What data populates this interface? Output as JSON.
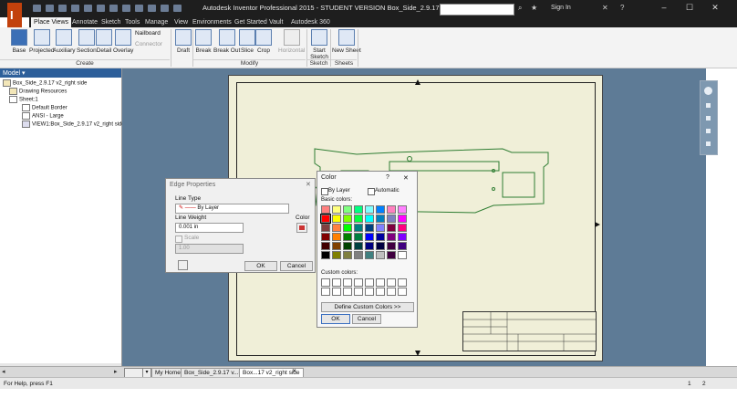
{
  "window": {
    "title": "Autodesk Inventor Professional 2015 - STUDENT VERSION   Box_Side_2.9.17 v2_right side",
    "sign_in": "Sign In",
    "logo_letter": "I",
    "minimize": "–",
    "maximize": "☐",
    "close": "✕"
  },
  "tabs": [
    "Place Views",
    "Annotate",
    "Sketch",
    "Tools",
    "Manage",
    "View",
    "Environments",
    "Get Started",
    "Vault",
    "Autodesk 360"
  ],
  "ribbon": {
    "create": {
      "label": "Create",
      "buttons": [
        "Base",
        "Projected",
        "Auxiliary",
        "Section",
        "Detail",
        "Overlay"
      ],
      "small": [
        "Nailboard",
        "Connector"
      ]
    },
    "draft": "Draft",
    "modify": {
      "label": "Modify",
      "buttons": [
        "Break",
        "Break Out",
        "Slice",
        "Crop",
        "Horizontal"
      ]
    },
    "sketch": {
      "label": "Sketch",
      "button": "Start Sketch"
    },
    "sheets": {
      "label": "Sheets",
      "button": "New Sheet"
    }
  },
  "browser": {
    "header": "Model ▾",
    "items": [
      "Box_Side_2.9.17 v2_right side",
      "Drawing Resources",
      "Sheet:1",
      "Default Border",
      "ANSI - Large",
      "VIEW1:Box_Side_2.9.17 v2_right side"
    ]
  },
  "edge_dialog": {
    "title": "Edge Properties",
    "line_type_label": "Line Type",
    "line_type_value": "By Layer",
    "line_weight_label": "Line Weight",
    "line_weight_value": "0.001 in",
    "color_label": "Color",
    "scale_label": "Scale",
    "scale_value": "1.00",
    "ok": "OK",
    "cancel": "Cancel",
    "close": "✕"
  },
  "color_dialog": {
    "title": "Color",
    "help": "?",
    "close": "✕",
    "by_layer": "By Layer",
    "automatic": "Automatic",
    "basic_colors_label": "Basic colors:",
    "custom_colors_label": "Custom colors:",
    "define_custom": "Define Custom Colors >>",
    "ok": "OK",
    "cancel": "Cancel",
    "basic_colors": [
      "#ff8080",
      "#ffff80",
      "#80ff80",
      "#00ff80",
      "#80ffff",
      "#0080ff",
      "#ff80c0",
      "#ff80ff",
      "#ff0000",
      "#ffff00",
      "#80ff00",
      "#00ff40",
      "#00ffff",
      "#0080c0",
      "#8080c0",
      "#ff00ff",
      "#804040",
      "#ff8040",
      "#00ff00",
      "#008080",
      "#004080",
      "#8080ff",
      "#800040",
      "#ff0080",
      "#800000",
      "#ff8000",
      "#008000",
      "#008040",
      "#0000ff",
      "#0000a0",
      "#800080",
      "#8000ff",
      "#400000",
      "#804000",
      "#004000",
      "#004040",
      "#000080",
      "#000040",
      "#400040",
      "#400080",
      "#000000",
      "#808000",
      "#808040",
      "#808080",
      "#408080",
      "#c0c0c0",
      "#400040",
      "#ffffff"
    ]
  },
  "doc_tabs": [
    "My Home",
    "Box_Side_2.9.17 v...ipt",
    "Box...17 v2_right side"
  ],
  "status": {
    "help": "For Help, press F1",
    "page_a": "1",
    "page_b": "2"
  }
}
